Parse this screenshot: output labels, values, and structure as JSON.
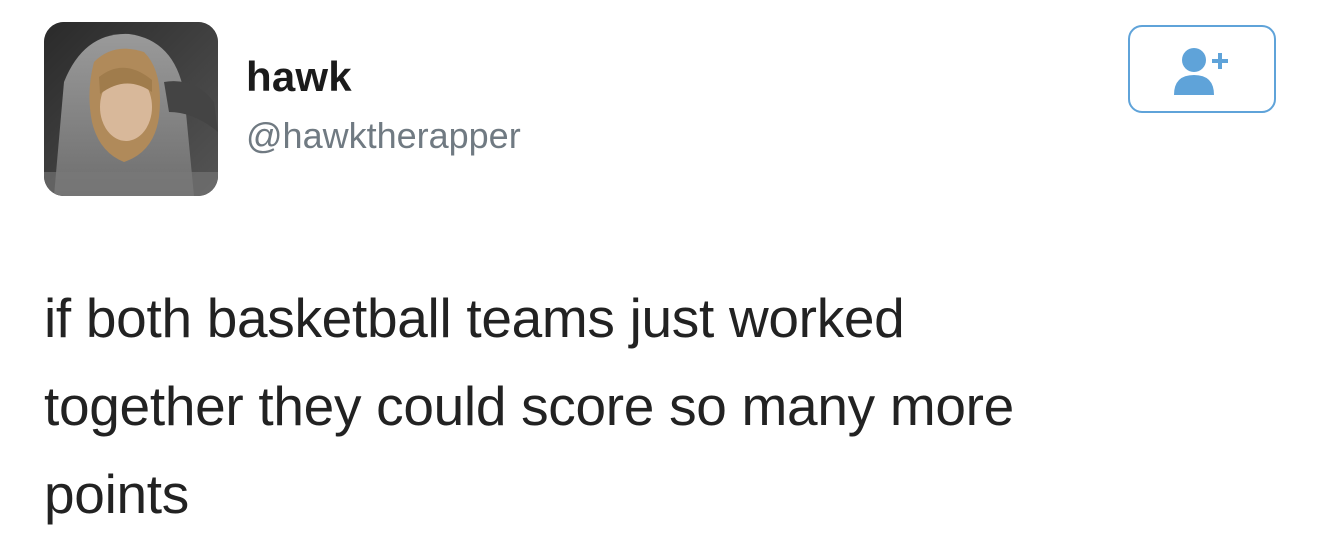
{
  "user": {
    "display_name": "hawk",
    "handle": "@hawktherapper",
    "avatar_icon": "profile-photo"
  },
  "follow_button": {
    "icon": "add-user-icon",
    "accent_color": "#5fa3d9"
  },
  "tweet": {
    "lines": [
      "if both basketball teams just worked",
      "together they could score so many more",
      "points"
    ]
  }
}
